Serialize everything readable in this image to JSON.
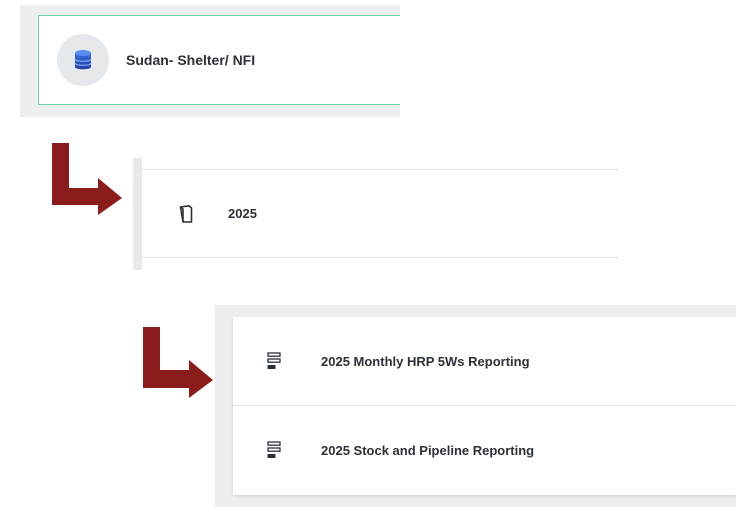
{
  "database": {
    "name": "Sudan- Shelter/ NFI",
    "icon": "database-icon",
    "border_color": "#6fd3a8"
  },
  "folder": {
    "name": "2025",
    "icon": "folder-icon"
  },
  "forms": [
    {
      "name": "2025 Monthly HRP 5Ws Reporting",
      "icon": "form-icon"
    },
    {
      "name": "2025 Stock and Pipeline Reporting",
      "icon": "form-icon"
    }
  ],
  "colors": {
    "arrow": "#8b1c1c",
    "text": "#2b3138",
    "panel_bg": "#eceef0"
  }
}
